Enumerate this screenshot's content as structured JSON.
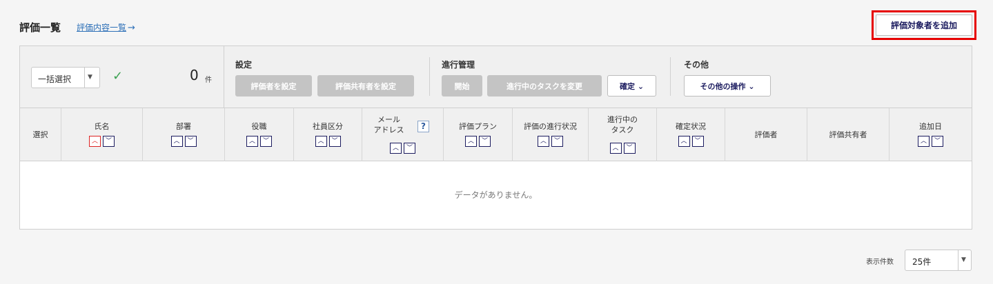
{
  "header": {
    "title": "評価一覧",
    "list_link": "評価内容一覧",
    "list_link_arrow": "→",
    "add_button": "評価対象者を追加"
  },
  "toolbar": {
    "bulk_select": "一括選択",
    "count": "0",
    "count_unit": "件",
    "settings": {
      "label": "設定",
      "buttons": [
        "評価者を設定",
        "評価共有者を設定"
      ]
    },
    "progress": {
      "label": "進行管理",
      "buttons": [
        "開始",
        "進行中のタスクを変更"
      ],
      "dropdown": "確定"
    },
    "other": {
      "label": "その他",
      "dropdown": "その他の操作"
    }
  },
  "icons": {
    "check": "check-icon",
    "caret": "caret-down-icon",
    "chevron": "chevron-down-icon",
    "sort_up": "sort-asc-icon",
    "sort_down": "sort-desc-icon",
    "help": "help-icon"
  },
  "table": {
    "columns": [
      {
        "label": "選択"
      },
      {
        "label": "氏名"
      },
      {
        "label": "部署"
      },
      {
        "label": "役職"
      },
      {
        "label": "社員区分"
      },
      {
        "label": "メール\nアドレス"
      },
      {
        "label": "評価プラン"
      },
      {
        "label": "評価の進行状況"
      },
      {
        "label": "進行中の\nタスク"
      },
      {
        "label": "確定状況"
      },
      {
        "label": "評価者"
      },
      {
        "label": "評価共有者"
      },
      {
        "label": "追加日"
      }
    ],
    "help_mark": "?",
    "empty_message": "データがありません。"
  },
  "pagination": {
    "per_page_label": "表示件数",
    "per_page_value": "25件"
  },
  "colors": {
    "highlight_border": "#e60000",
    "link": "#2c6fb7",
    "sort_active": "#dd2222",
    "navy": "#1a1a5e"
  }
}
